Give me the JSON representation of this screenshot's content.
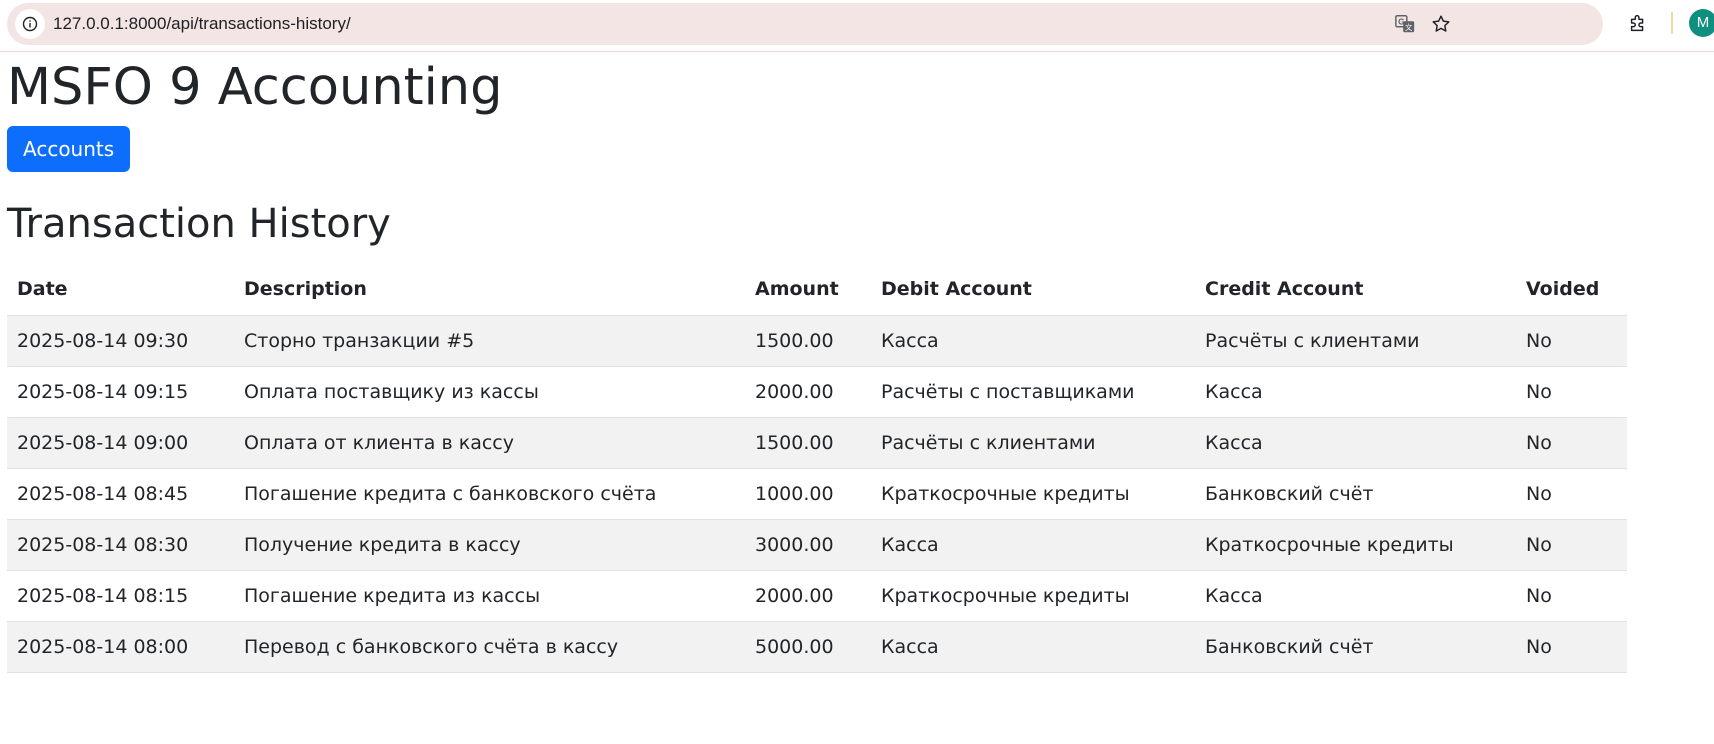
{
  "browser": {
    "url": "127.0.0.1:8000/api/transactions-history/",
    "profile_initial": "M"
  },
  "page": {
    "title": "MSFO 9 Accounting",
    "accounts_button": "Accounts",
    "section_title": "Transaction History"
  },
  "table": {
    "headers": {
      "date": "Date",
      "description": "Description",
      "amount": "Amount",
      "debit": "Debit Account",
      "credit": "Credit Account",
      "voided": "Voided"
    },
    "rows": [
      {
        "date": "2025-08-14 09:30",
        "description": "Сторно транзакции #5",
        "amount": "1500.00",
        "debit": "Касса",
        "credit": "Расчёты с клиентами",
        "voided": "No"
      },
      {
        "date": "2025-08-14 09:15",
        "description": "Оплата поставщику из кассы",
        "amount": "2000.00",
        "debit": "Расчёты с поставщиками",
        "credit": "Касса",
        "voided": "No"
      },
      {
        "date": "2025-08-14 09:00",
        "description": "Оплата от клиента в кассу",
        "amount": "1500.00",
        "debit": "Расчёты с клиентами",
        "credit": "Касса",
        "voided": "No"
      },
      {
        "date": "2025-08-14 08:45",
        "description": "Погашение кредита с банковского счёта",
        "amount": "1000.00",
        "debit": "Краткосрочные кредиты",
        "credit": "Банковский счёт",
        "voided": "No"
      },
      {
        "date": "2025-08-14 08:30",
        "description": "Получение кредита в кассу",
        "amount": "3000.00",
        "debit": "Касса",
        "credit": "Краткосрочные кредиты",
        "voided": "No"
      },
      {
        "date": "2025-08-14 08:15",
        "description": "Погашение кредита из кассы",
        "amount": "2000.00",
        "debit": "Краткосрочные кредиты",
        "credit": "Касса",
        "voided": "No"
      },
      {
        "date": "2025-08-14 08:00",
        "description": "Перевод с банковского счёта в кассу",
        "amount": "5000.00",
        "debit": "Касса",
        "credit": "Банковский счёт",
        "voided": "No"
      }
    ]
  },
  "colors": {
    "primary_button": "#0d6efd",
    "striped_row": "#f2f2f2",
    "omnibox": "#f3e5e3"
  }
}
